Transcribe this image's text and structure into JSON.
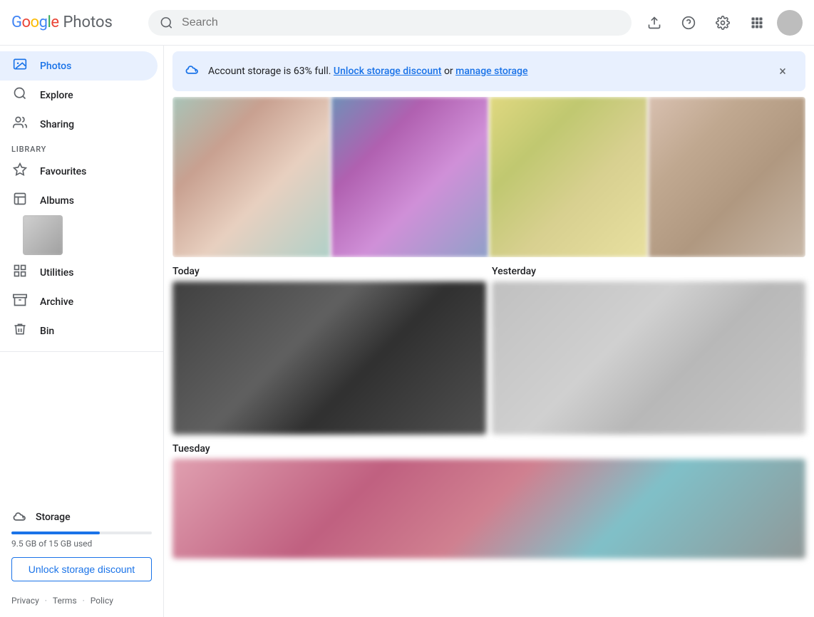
{
  "header": {
    "logo_google": "Google",
    "logo_photos": "Photos",
    "search_placeholder": "Search",
    "upload_label": "Upload",
    "help_label": "Help",
    "settings_label": "Settings",
    "apps_label": "Google apps"
  },
  "sidebar": {
    "nav_items": [
      {
        "id": "photos",
        "label": "Photos",
        "icon": "🏠",
        "active": true
      },
      {
        "id": "explore",
        "label": "Explore",
        "icon": "🔍",
        "active": false
      },
      {
        "id": "sharing",
        "label": "Sharing",
        "icon": "👥",
        "active": false
      }
    ],
    "library_label": "LIBRARY",
    "library_items": [
      {
        "id": "favourites",
        "label": "Favourites",
        "icon": "⭐"
      },
      {
        "id": "albums",
        "label": "Albums",
        "icon": "📷"
      }
    ],
    "utility_items": [
      {
        "id": "utilities",
        "label": "Utilities",
        "icon": "☑"
      },
      {
        "id": "archive",
        "label": "Archive",
        "icon": "📥"
      },
      {
        "id": "bin",
        "label": "Bin",
        "icon": "🗑"
      }
    ],
    "storage": {
      "label": "Storage",
      "icon": "☁",
      "used_text": "9.5 GB of 15 GB used",
      "percent": 63,
      "bar_width": "63%",
      "unlock_label": "Unlock storage discount"
    },
    "footer": {
      "privacy_label": "Privacy",
      "terms_label": "Terms",
      "policy_label": "Policy"
    }
  },
  "banner": {
    "icon": "☁",
    "message": "Account storage is 63% full.",
    "unlock_link_label": "Unlock storage discount",
    "or_text": "or",
    "manage_link_label": "manage storage",
    "close_label": "×"
  },
  "content": {
    "today_label": "Today",
    "yesterday_label": "Yesterday",
    "tuesday_label": "Tuesday"
  }
}
